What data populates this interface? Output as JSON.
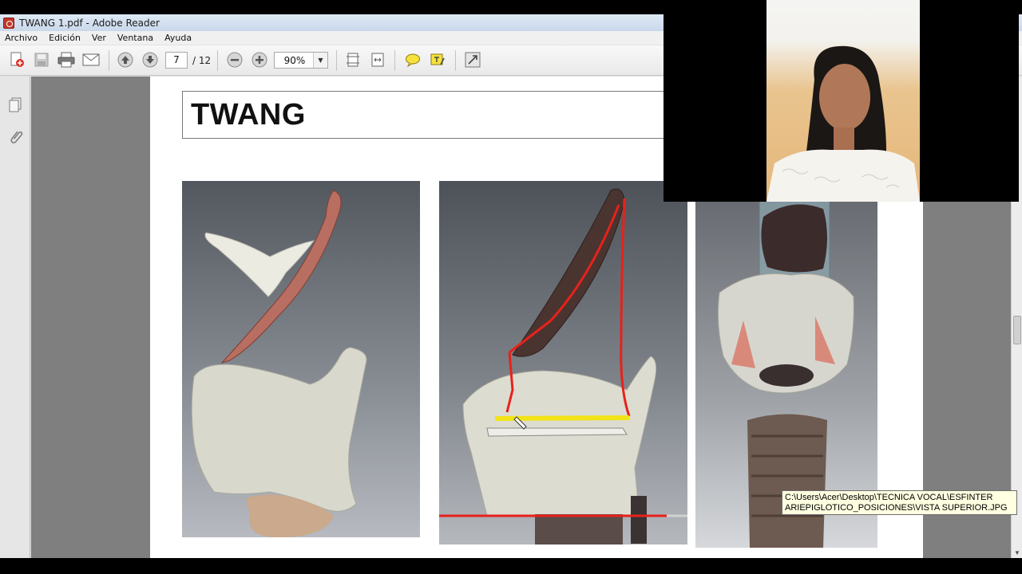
{
  "window": {
    "title": "TWANG 1.pdf - Adobe Reader"
  },
  "menubar": {
    "items": [
      "Archivo",
      "Edición",
      "Ver",
      "Ventana",
      "Ayuda"
    ]
  },
  "toolbar": {
    "current_page": "7",
    "total_pages": "/ 12",
    "zoom": "90%",
    "buttons": [
      "create-pdf-icon",
      "save-icon",
      "print-icon",
      "email-icon",
      "previous-page-icon",
      "next-page-icon",
      "zoom-out-icon",
      "zoom-in-icon",
      "fit-page-icon",
      "fit-width-icon",
      "comment-icon",
      "highlight-icon",
      "expand-icon"
    ]
  },
  "leftpanel": {
    "icons": [
      "pages-icon",
      "attachments-icon"
    ]
  },
  "document": {
    "slide_title": "TWANG"
  },
  "tooltip": {
    "line1": "C:\\Users\\Acer\\Desktop\\TECNICA VOCAL\\ESFINTER",
    "line2": "ARIEPIGLOTICO_POSICIONES\\VISTA SUPERIOR.JPG"
  },
  "colors": {
    "annotation_red": "#e8211b",
    "annotation_yellow": "#f2e416",
    "document_bg": "#7f7f7f",
    "tooltip_bg": "#ffffe1"
  }
}
